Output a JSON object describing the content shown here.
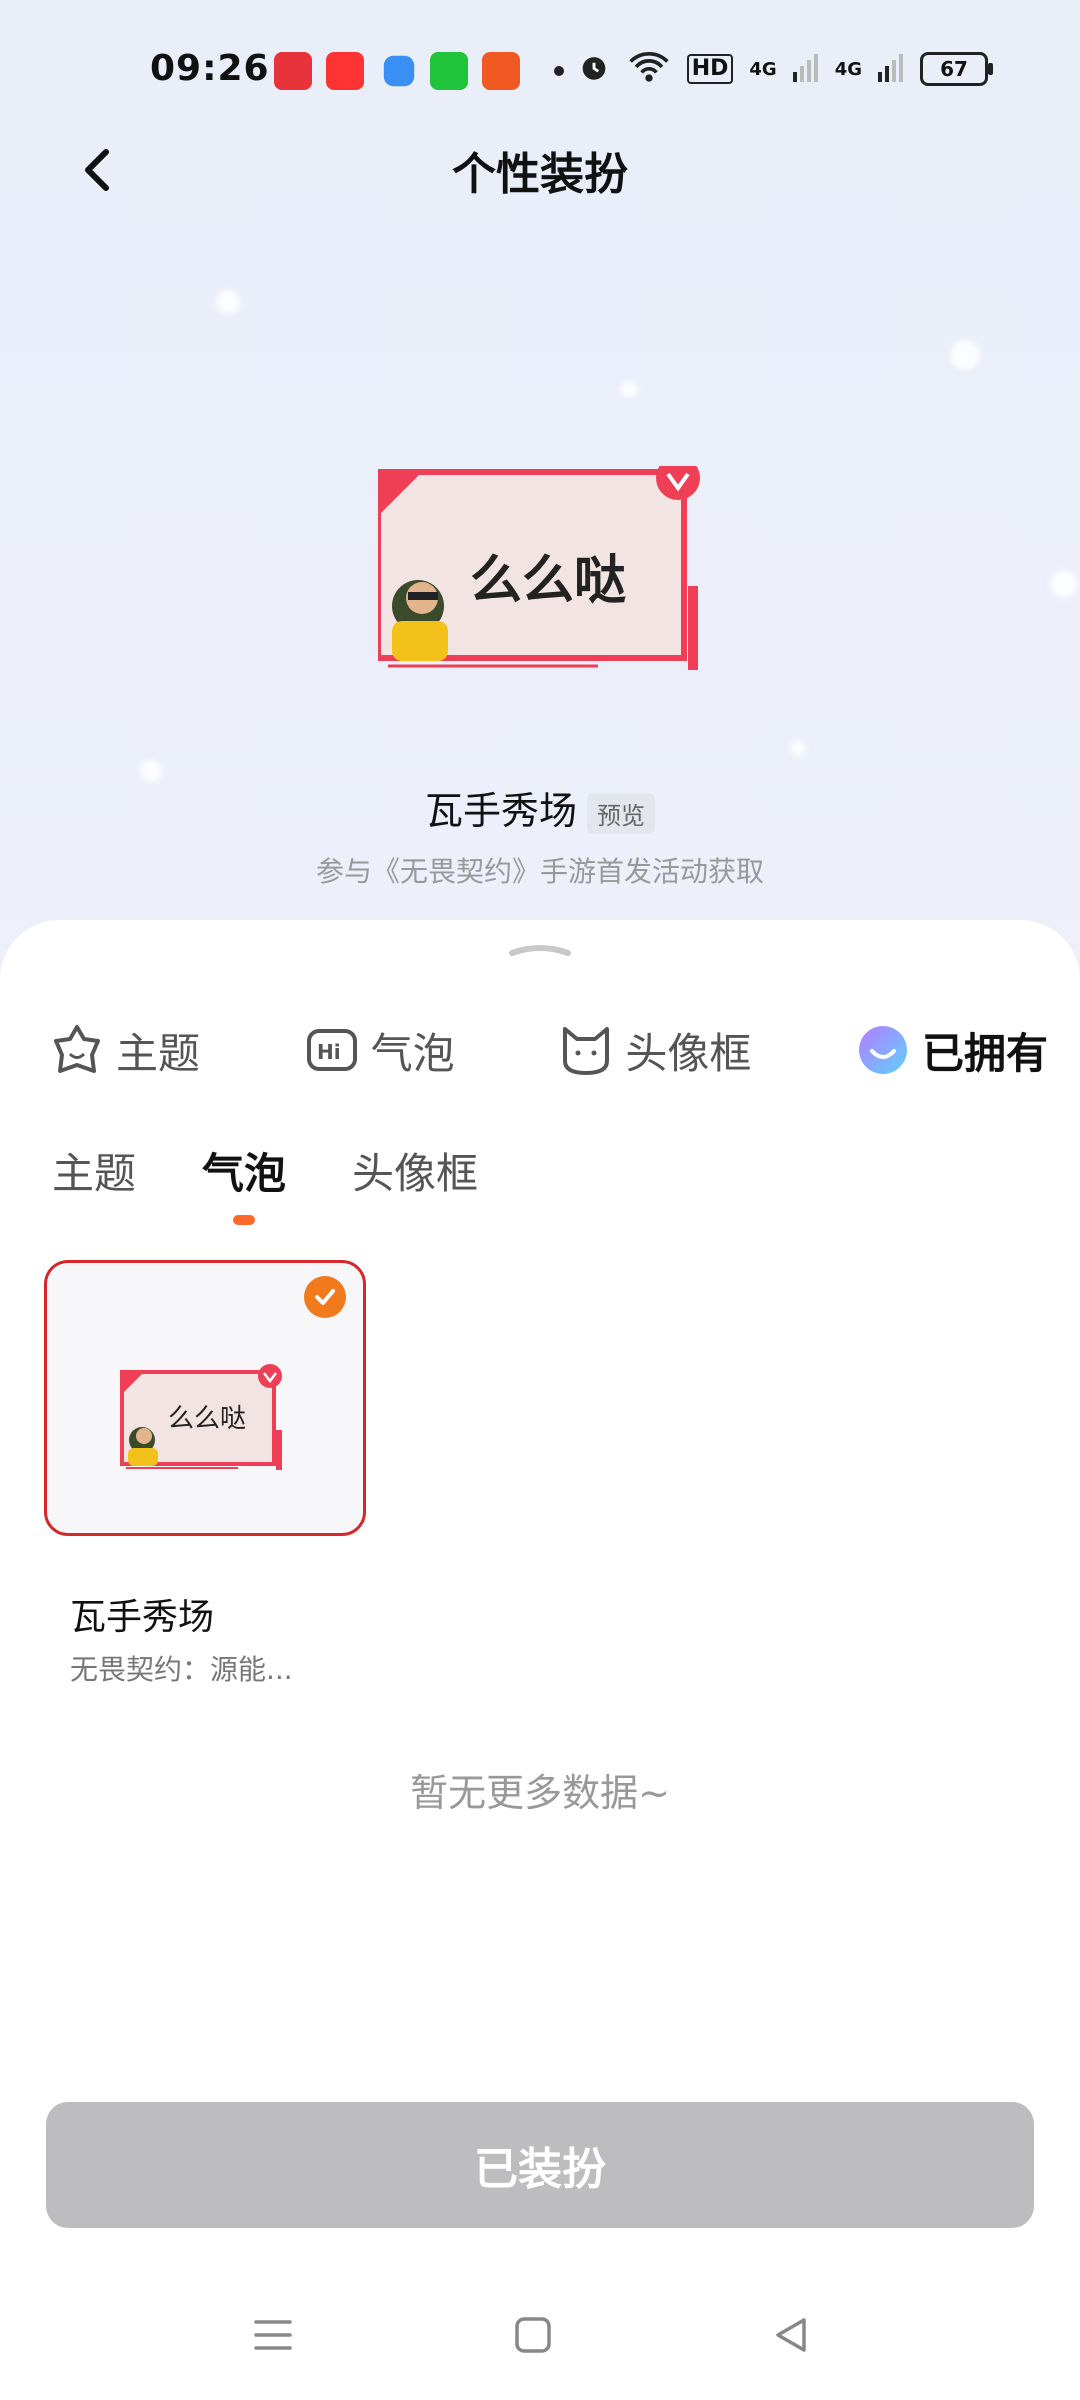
{
  "status_bar": {
    "time": "09:26",
    "hd_label": "HD",
    "signal1": "4G",
    "signal2": "4G",
    "battery": "67"
  },
  "header": {
    "title": "个性装扮"
  },
  "preview": {
    "bubble_text": "么么哒",
    "name": "瓦手秀场",
    "badge": "预览",
    "description": "参与《无畏契约》手游首发活动获取"
  },
  "category_tabs": [
    {
      "label": "主题",
      "icon": "theme-face-icon"
    },
    {
      "label": "气泡",
      "icon": "bubble-hi-icon"
    },
    {
      "label": "头像框",
      "icon": "cat-avatar-icon"
    },
    {
      "label": "已拥有",
      "icon": "owned-smile-icon"
    }
  ],
  "sub_tabs": [
    {
      "label": "主题"
    },
    {
      "label": "气泡",
      "active": true
    },
    {
      "label": "头像框"
    }
  ],
  "items": [
    {
      "bubble_text": "么么哒",
      "title": "瓦手秀场",
      "subtitle": "无畏契约：源能...",
      "selected": true
    }
  ],
  "empty_text": "暂无更多数据~",
  "action_button": "已装扮",
  "colors": {
    "accent": "#ff6a2b",
    "selected_border": "#d4282a",
    "button_bg": "#bdbcbf"
  }
}
